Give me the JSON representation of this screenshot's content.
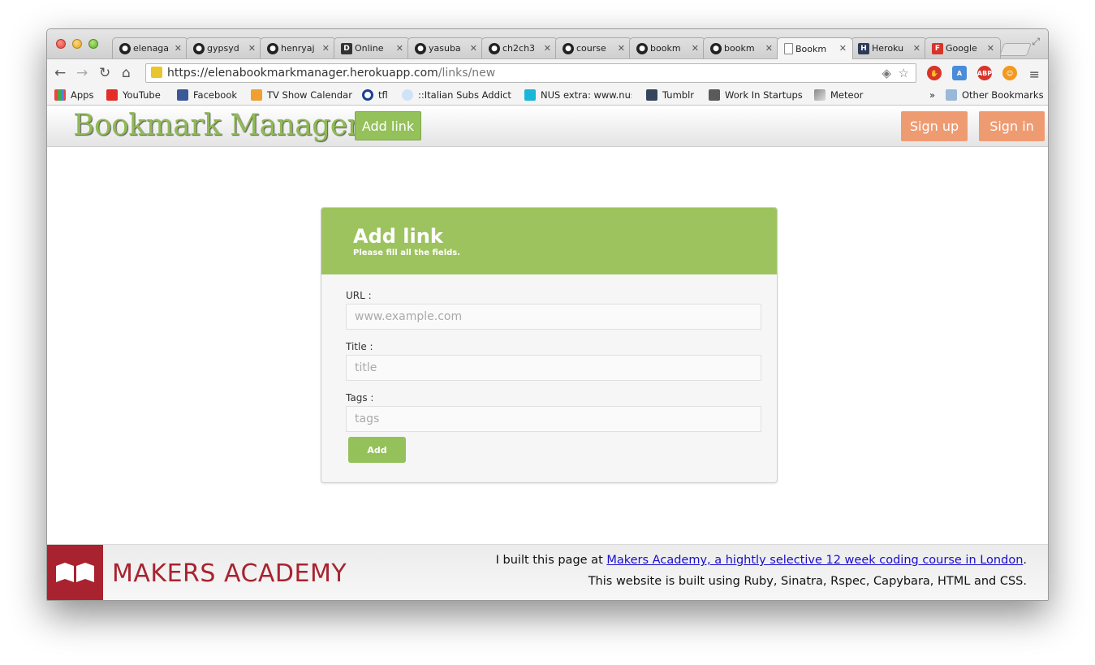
{
  "browser": {
    "tabs": [
      {
        "label": "elenaga",
        "icon": "github-icon"
      },
      {
        "label": "gypsyd",
        "icon": "github-icon"
      },
      {
        "label": "henryaj",
        "icon": "github-icon"
      },
      {
        "label": "Online",
        "icon": "d-icon"
      },
      {
        "label": "yasuba",
        "icon": "github-icon"
      },
      {
        "label": "ch2ch3",
        "icon": "github-icon"
      },
      {
        "label": "course",
        "icon": "github-icon"
      },
      {
        "label": "bookm",
        "icon": "github-icon"
      },
      {
        "label": "bookm",
        "icon": "github-icon"
      },
      {
        "label": "Bookm",
        "icon": "document-icon",
        "active": true
      },
      {
        "label": "Heroku",
        "icon": "heroku-icon"
      },
      {
        "label": "Google",
        "icon": "google-docs-icon"
      }
    ],
    "url_main": "https://elenabookmarkmanager.herokuapp.com",
    "url_path": "/links/new",
    "bookmarks": [
      {
        "label": "Apps",
        "icon": "apps-grid-icon"
      },
      {
        "label": "YouTube",
        "icon": "youtube-icon"
      },
      {
        "label": "Facebook",
        "icon": "facebook-icon"
      },
      {
        "label": "TV Show Calendar",
        "icon": "tv-icon"
      },
      {
        "label": "tfl",
        "icon": "tfl-roundel-icon"
      },
      {
        "label": "::Italian Subs Addict::",
        "icon": "italian-subs-icon"
      },
      {
        "label": "NUS extra: www.nus",
        "icon": "nus-icon"
      },
      {
        "label": "Tumblr",
        "icon": "tumblr-icon"
      },
      {
        "label": "Work In Startups",
        "icon": "wis-icon"
      },
      {
        "label": "Meteor",
        "icon": "meteor-icon"
      }
    ],
    "other_bookmarks": "Other Bookmarks",
    "chevron": "»"
  },
  "site": {
    "brand": "Bookmark Manager",
    "add_link_btn": "Add link",
    "signup_btn": "Sign up",
    "signin_btn": "Sign in"
  },
  "form": {
    "title": "Add link",
    "subtitle": "Please fill all the fields.",
    "url_label": "URL :",
    "url_placeholder": "www.example.com",
    "title_label": "Title :",
    "title_placeholder": "title",
    "tags_label": "Tags :",
    "tags_placeholder": "tags",
    "submit": "Add"
  },
  "footer": {
    "logo_text": "MAKERS ACADEMY",
    "line1_prefix": "I built this page at ",
    "line1_link": "Makers Academy, a hightly selective 12 week coding course in London",
    "line1_suffix": ".",
    "line2": "This website is built using Ruby, Sinatra, Rspec, Capybara, HTML and CSS."
  },
  "colors": {
    "green": "#9dc35f",
    "orange": "#ef9b72",
    "makers_red": "#a8232f"
  }
}
